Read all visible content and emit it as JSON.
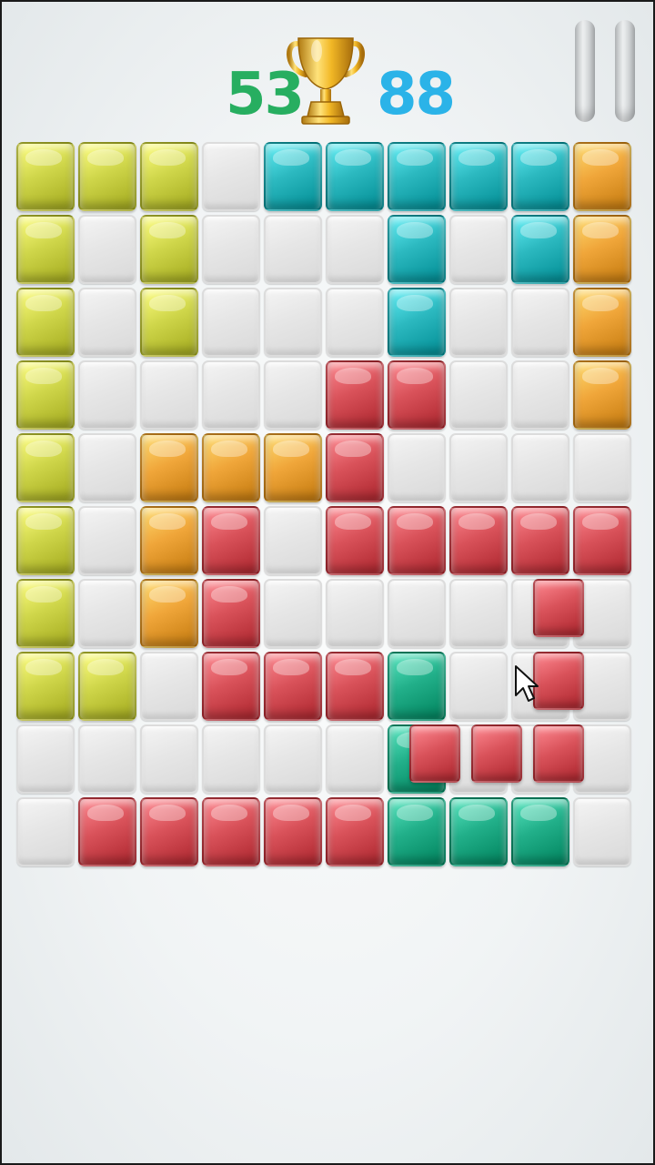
{
  "header": {
    "current_score": "53",
    "best_score": "88",
    "trophy_icon": "trophy-icon",
    "pause_icon": "pause-icon"
  },
  "palette": {
    "Y": "#cfd64a",
    "O": "#f0a63a",
    "T": "#2cb9c0",
    "R": "#d9525a",
    "G": "#22b08a",
    "empty": "#e8e8e8"
  },
  "board": {
    "columns": 10,
    "rows": [
      [
        "Y",
        "Y",
        "Y",
        "",
        "T",
        "T",
        "T",
        "T",
        "T",
        "O"
      ],
      [
        "Y",
        "",
        "Y",
        "",
        "",
        "",
        "T",
        "",
        "T",
        "O"
      ],
      [
        "Y",
        "",
        "Y",
        "",
        "",
        "",
        "T",
        "",
        "",
        "O"
      ],
      [
        "Y",
        "",
        "",
        "",
        "",
        "R",
        "R",
        "",
        "",
        "O"
      ],
      [
        "Y",
        "",
        "O",
        "O",
        "O",
        "R",
        "",
        "",
        "",
        ""
      ],
      [
        "Y",
        "",
        "O",
        "R",
        "",
        "R",
        "R",
        "R",
        "R",
        "R"
      ],
      [
        "Y",
        "",
        "O",
        "R",
        "",
        "",
        "",
        "",
        "",
        ""
      ],
      [
        "Y",
        "Y",
        "",
        "R",
        "R",
        "R",
        "G",
        "",
        "",
        ""
      ],
      [
        "",
        "",
        "",
        "",
        "",
        "",
        "G",
        "",
        "",
        ""
      ],
      [
        "",
        "R",
        "R",
        "R",
        "R",
        "R",
        "G",
        "G",
        "G",
        ""
      ]
    ]
  },
  "dragged_piece": {
    "color": "R",
    "shape": "L",
    "block_count": 5
  }
}
